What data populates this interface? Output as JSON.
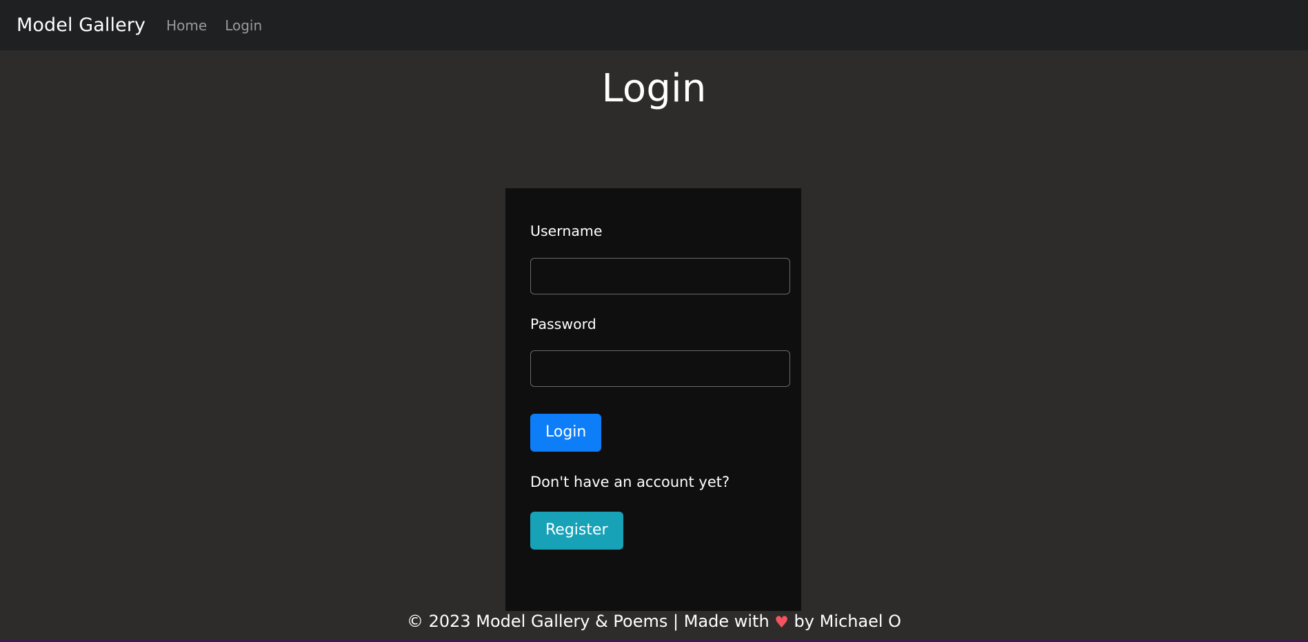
{
  "navbar": {
    "brand": "Model Gallery",
    "links": [
      {
        "label": "Home"
      },
      {
        "label": "Login"
      }
    ]
  },
  "main": {
    "title": "Login",
    "form": {
      "username": {
        "label": "Username",
        "value": "",
        "placeholder": ""
      },
      "password": {
        "label": "Password",
        "value": "",
        "placeholder": ""
      },
      "submit_label": "Login",
      "signup_prompt": "Don't have an account yet?",
      "register_label": "Register"
    }
  },
  "footer": {
    "text_before_heart": "© 2023 Model Gallery & Poems | Made with ",
    "heart_icon": "heart-icon",
    "heart_glyph": "♥",
    "text_after_heart": " by Michael O"
  },
  "colors": {
    "page_background": "#2e2c2b",
    "navbar_background": "#1f2022",
    "card_background": "#0f0f0f",
    "login_button": "#0d7ef8",
    "register_button": "#17a2b8",
    "heart": "#f4545f",
    "nav_link": "#9a9a9a",
    "input_border": "#6b6b6b",
    "bottom_strip": "#3d1a4a"
  }
}
